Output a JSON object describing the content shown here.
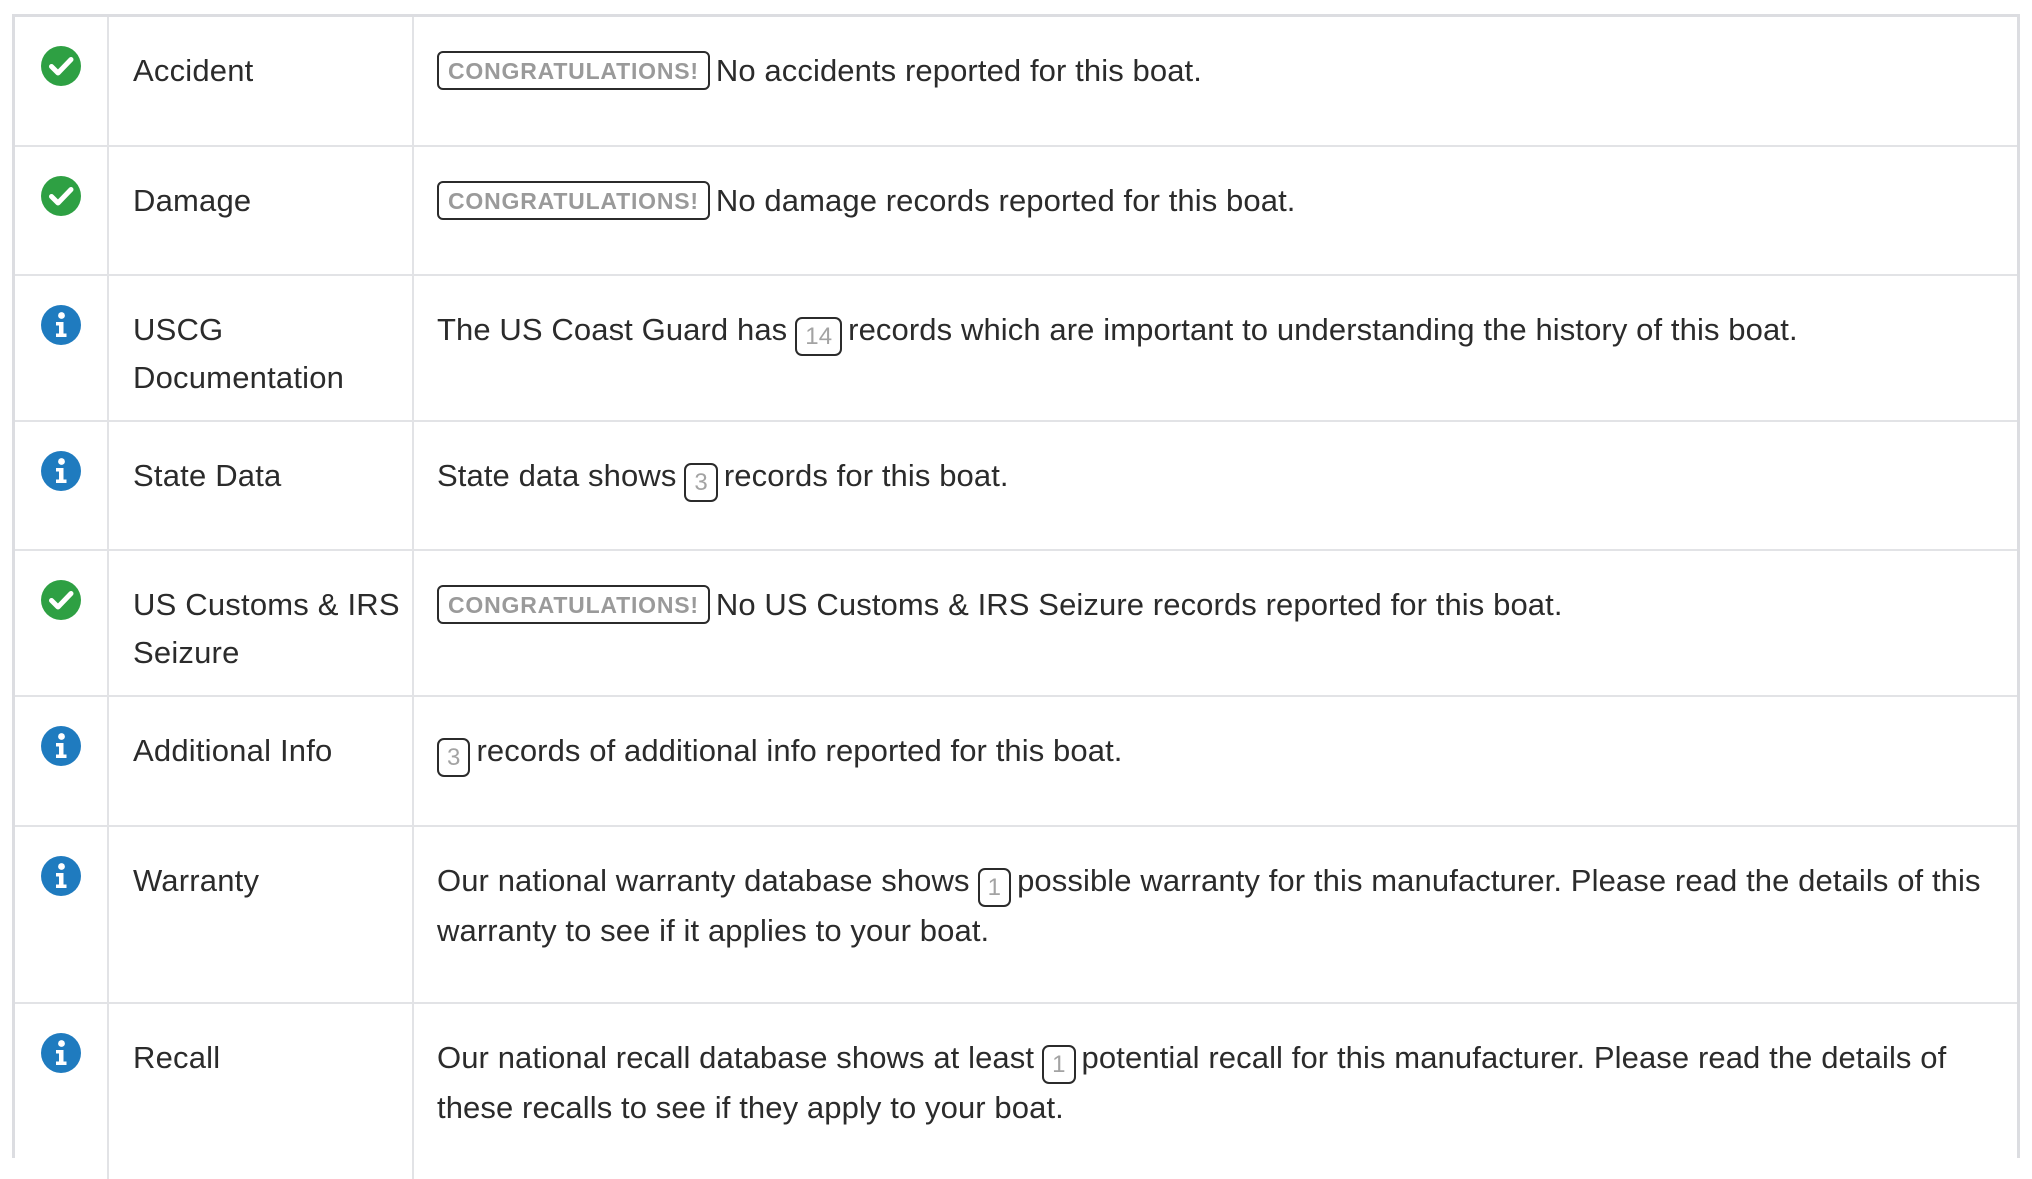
{
  "colors": {
    "success": "#2ea043",
    "info": "#1f7bbf",
    "border": "#e2e3e6"
  },
  "rows": [
    {
      "icon": "check-circle-icon",
      "category": "Accident",
      "badge": "CONGRATULATIONS!",
      "text": "No accidents reported for this boat."
    },
    {
      "icon": "check-circle-icon",
      "category": "Damage",
      "badge": "CONGRATULATIONS!",
      "text": "No damage records reported for this boat."
    },
    {
      "icon": "info-circle-icon",
      "category": "USCG Documentation",
      "text_before": "The US Coast Guard has",
      "count": "14",
      "text_after": "records which are important to understanding the history of this boat."
    },
    {
      "icon": "info-circle-icon",
      "category": "State Data",
      "text_before": "State data shows",
      "count": "3",
      "text_after": "records for this boat."
    },
    {
      "icon": "check-circle-icon",
      "category": "US Customs & IRS Seizure",
      "badge": "CONGRATULATIONS!",
      "text": "No US Customs & IRS Seizure records reported for this boat."
    },
    {
      "icon": "info-circle-icon",
      "category": "Additional Info",
      "count": "3",
      "text_after": "records of additional info reported for this boat."
    },
    {
      "icon": "info-circle-icon",
      "category": "Warranty",
      "text_before": "Our national warranty database shows",
      "count": "1",
      "text_after": "possible warranty for this manufacturer. Please read the details of this warranty to see if it applies to your boat."
    },
    {
      "icon": "info-circle-icon",
      "category": "Recall",
      "text_before": "Our national recall database shows at least",
      "count": "1",
      "text_after": "potential recall for this manufacturer. Please read the details of these recalls to see if they apply to your boat."
    }
  ]
}
